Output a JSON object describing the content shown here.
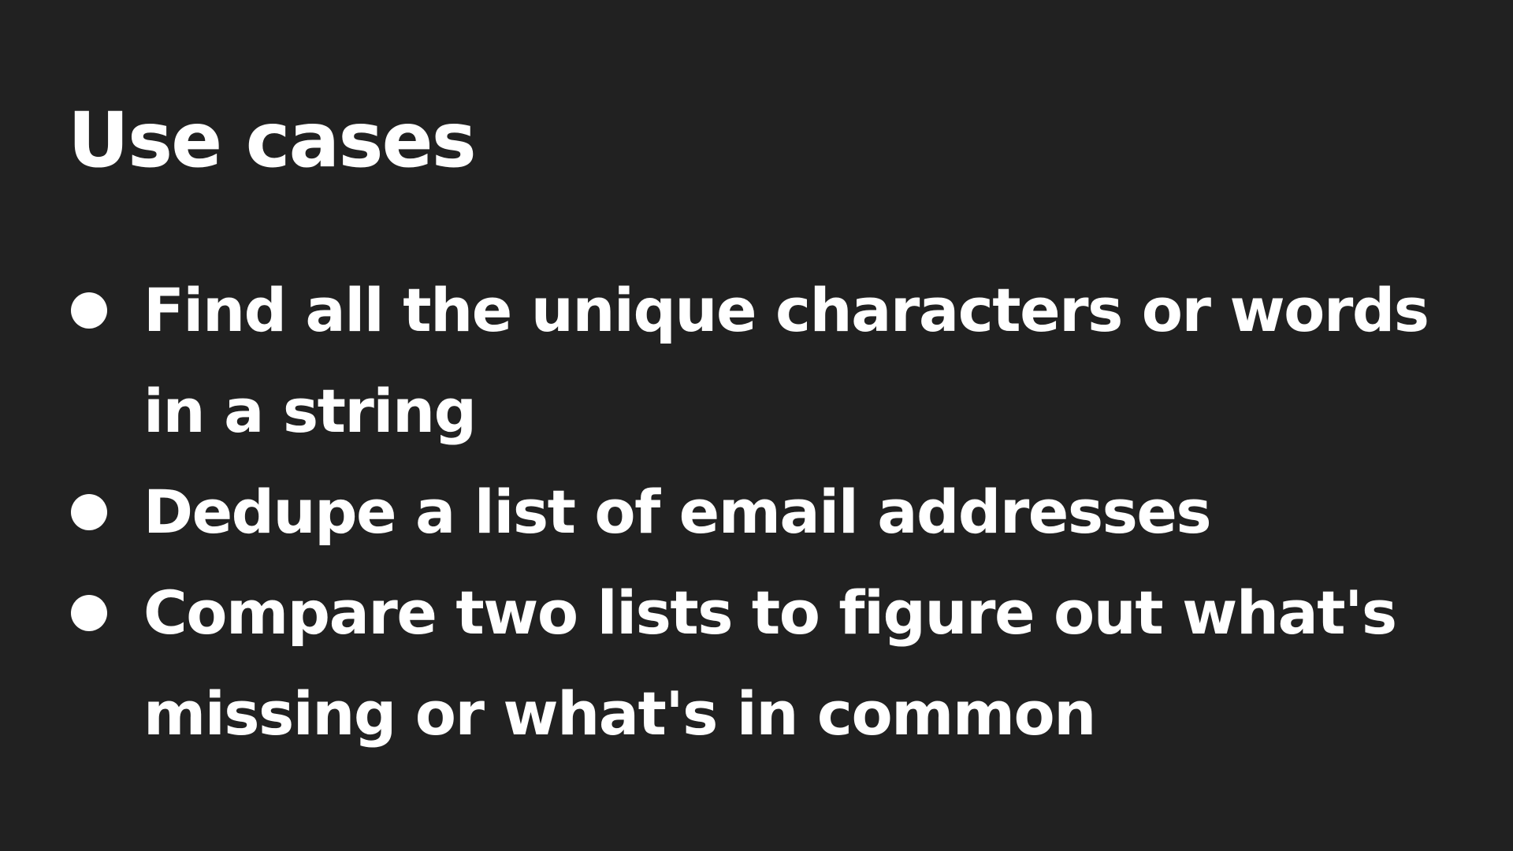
{
  "slide": {
    "title": "Use cases",
    "bullets": [
      "Find all the unique characters or words in a string",
      "Dedupe a list of email addresses",
      "Compare two lists to figure out what's missing or what's in common"
    ]
  },
  "colors": {
    "background": "#212121",
    "text": "#ffffff"
  }
}
